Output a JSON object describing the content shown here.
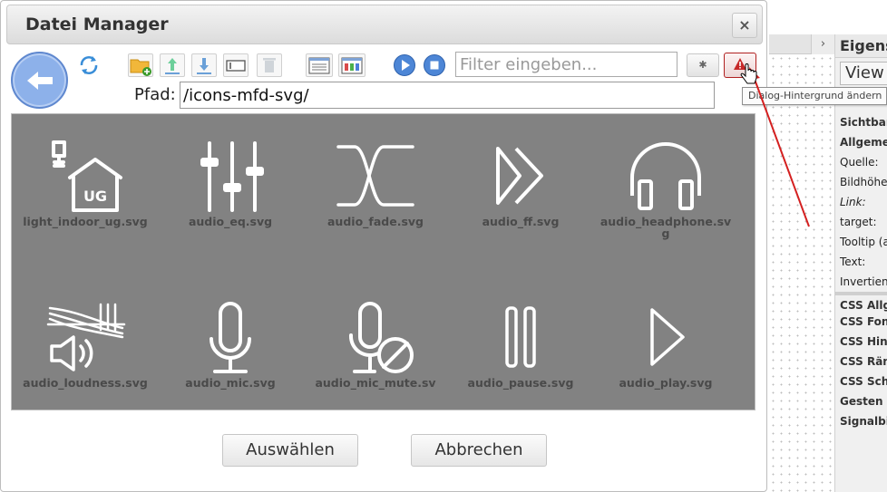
{
  "editor": {
    "panel_title": "Eigens",
    "view_label": "View",
    "collapse_glyph": "›",
    "rows": [
      {
        "label": "Sichtbar",
        "style": "bold"
      },
      {
        "label": "Allgeme",
        "style": "bold"
      },
      {
        "label": "Quelle:",
        "style": "normal"
      },
      {
        "label": "Bildhöhe",
        "style": "normal"
      },
      {
        "label": "Link:",
        "style": "italic"
      },
      {
        "label": "target:",
        "style": "normal"
      },
      {
        "label": "Tooltip (a",
        "style": "normal"
      },
      {
        "label": "Text:",
        "style": "normal"
      },
      {
        "label": "Invertien",
        "style": "normal"
      },
      {
        "label": "CSS Allg",
        "style": "bold"
      },
      {
        "label": "CSS Fon",
        "style": "bold"
      },
      {
        "label": "CSS Hin",
        "style": "bold"
      },
      {
        "label": "CSS Rän",
        "style": "bold"
      },
      {
        "label": "CSS Sch",
        "style": "bold"
      },
      {
        "label": "Gesten",
        "style": "bold"
      },
      {
        "label": "Signalbi",
        "style": "bold"
      }
    ]
  },
  "dialog": {
    "title": "Datei Manager",
    "close_glyph": "×",
    "toolbar": {
      "icons": [
        "back-arrow-icon",
        "refresh-icon",
        "new-folder-icon",
        "upload-icon",
        "download-icon",
        "rename-icon",
        "delete-icon",
        "list-view-icon",
        "table-view-icon",
        "play-icon",
        "stop-icon",
        "settings-icon",
        "warning-icon"
      ],
      "filter_placeholder": "Filter eingeben...",
      "filter_value": "",
      "gear_glyph": "✱",
      "warning_tooltip": "Dialog-Hintergrund ändern"
    },
    "path": {
      "label": "Pfad:",
      "value": "/icons-mfd-svg/"
    },
    "files": [
      {
        "name": "light_indoor_ug.svg",
        "icon": "light-indoor-ug-icon"
      },
      {
        "name": "audio_eq.svg",
        "icon": "audio-eq-icon"
      },
      {
        "name": "audio_fade.svg",
        "icon": "audio-fade-icon"
      },
      {
        "name": "audio_ff.svg",
        "icon": "audio-ff-icon"
      },
      {
        "name": "audio_headphone.svg",
        "icon": "audio-headphone-icon"
      },
      {
        "name": "audio_loudness.svg",
        "icon": "audio-loudness-icon"
      },
      {
        "name": "audio_mic.svg",
        "icon": "audio-mic-icon"
      },
      {
        "name": "audio_mic_mute.sv",
        "icon": "audio-mic-mute-icon"
      },
      {
        "name": "audio_pause.svg",
        "icon": "audio-pause-icon"
      },
      {
        "name": "audio_play.svg",
        "icon": "audio-play-icon"
      }
    ],
    "buttons": {
      "select": "Auswählen",
      "cancel": "Abbrechen"
    }
  },
  "colors": {
    "grid_bg": "#828282",
    "icon_stroke": "#ffffff",
    "warning_red": "#b02020",
    "accent_blue": "#8db1ea",
    "annotation_red": "#d42020"
  }
}
